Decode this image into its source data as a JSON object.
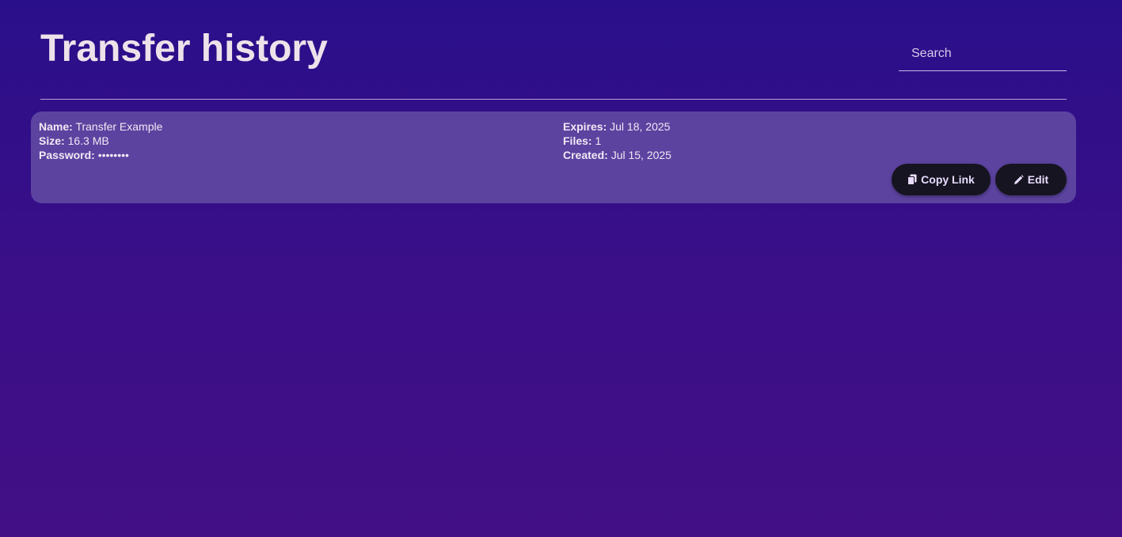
{
  "header": {
    "title": "Transfer history",
    "search_placeholder": "Search"
  },
  "transfer": {
    "name_label": "Name:",
    "name_value": "Transfer Example",
    "size_label": "Size:",
    "size_value": "16.3 MB",
    "password_label": "Password:",
    "password_value": "••••••••",
    "expires_label": "Expires:",
    "expires_value": "Jul 18, 2025",
    "files_label": "Files:",
    "files_value": "1",
    "created_label": "Created:",
    "created_value": "Jul 15, 2025",
    "copy_link_label": "Copy Link",
    "edit_label": "Edit"
  },
  "icons": {
    "copy": "copy-icon",
    "edit": "pencil-icon"
  },
  "colors": {
    "background": "#2a0f8a",
    "card": "#5c43a0",
    "button": "#161420",
    "button_text": "#e9dcff"
  }
}
